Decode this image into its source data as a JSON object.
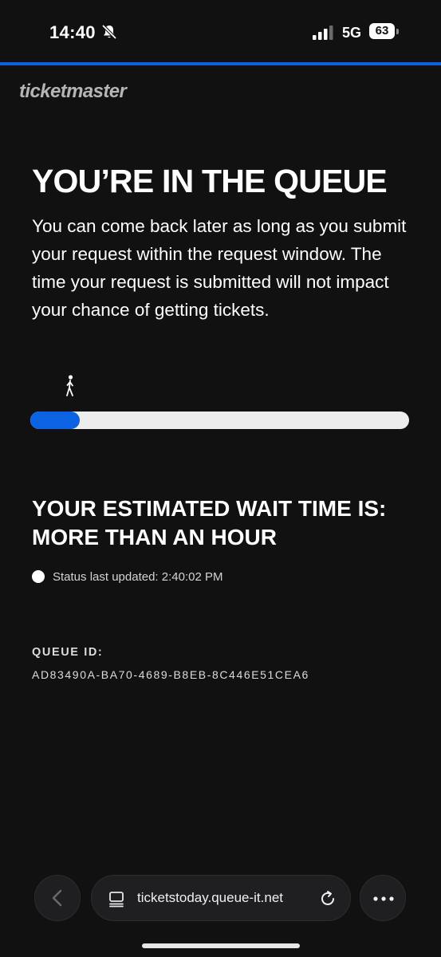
{
  "status_bar": {
    "time": "14:40",
    "network": "5G",
    "battery": "63",
    "icons": [
      "bell-slash-icon",
      "signal-icon",
      "battery-icon"
    ]
  },
  "brand": {
    "logo_text": "ticketmaster"
  },
  "queue": {
    "title": "YOU’RE IN THE QUEUE",
    "description": "You can come back later as long as you submit your request within the request window. The time your request is submitted will not impact your chance of getting tickets.",
    "progress_fraction": 0.13,
    "wait_title": "YOUR ESTIMATED WAIT TIME IS: MORE THAN AN HOUR",
    "status_text": "Status last updated: 2:40:02 PM",
    "queue_id_label": "QUEUE ID:",
    "queue_id": "AD83490A-BA70-4689-B8EB-8C446E51CEA6"
  },
  "browser": {
    "url": "ticketstoday.queue-it.net",
    "icons": [
      "chevron-left-icon",
      "page-icon",
      "reload-icon",
      "more-icon"
    ]
  },
  "colors": {
    "background": "#111112",
    "accent": "#0b62e3",
    "progress_track": "#ededed"
  }
}
